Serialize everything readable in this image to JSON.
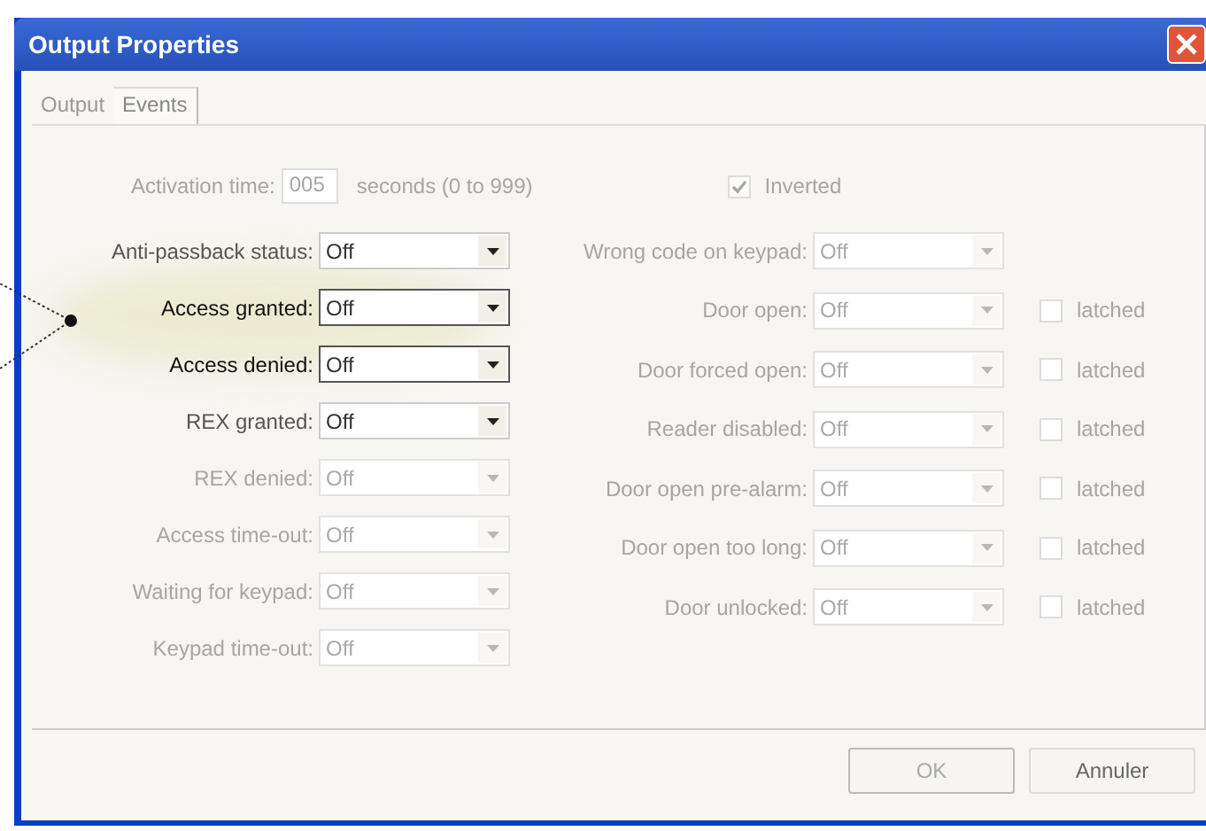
{
  "window": {
    "title": "Output Properties"
  },
  "tabs": [
    {
      "label": "Output",
      "selected": false
    },
    {
      "label": "Events",
      "selected": true
    }
  ],
  "activation": {
    "label": "Activation time:",
    "value": "005",
    "unit": "seconds (0 to 999)",
    "disabled": true
  },
  "inverted": {
    "label": "Inverted",
    "checked": true,
    "disabled": true
  },
  "left_fields": [
    {
      "label": "Anti-passback status:",
      "value": "Off",
      "disabled": false,
      "highlighted": false
    },
    {
      "label": "Access granted:",
      "value": "Off",
      "disabled": false,
      "highlighted": true
    },
    {
      "label": "Access denied:",
      "value": "Off",
      "disabled": false,
      "highlighted": true
    },
    {
      "label": "REX granted:",
      "value": "Off",
      "disabled": false,
      "highlighted": false
    },
    {
      "label": "REX denied:",
      "value": "Off",
      "disabled": true,
      "highlighted": false
    },
    {
      "label": "Access time-out:",
      "value": "Off",
      "disabled": true,
      "highlighted": false
    },
    {
      "label": "Waiting for keypad:",
      "value": "Off",
      "disabled": true,
      "highlighted": false
    },
    {
      "label": "Keypad time-out:",
      "value": "Off",
      "disabled": true,
      "highlighted": false
    }
  ],
  "right_fields": [
    {
      "label": "Wrong code on keypad:",
      "value": "Off",
      "disabled": true
    },
    {
      "label": "Door open:",
      "value": "Off",
      "disabled": true,
      "latched": {
        "label": "latched",
        "checked": false
      }
    },
    {
      "label": "Door forced open:",
      "value": "Off",
      "disabled": true,
      "latched": {
        "label": "latched",
        "checked": false
      }
    },
    {
      "label": "Reader disabled:",
      "value": "Off",
      "disabled": true,
      "latched": {
        "label": "latched",
        "checked": false
      }
    },
    {
      "label": "Door open pre-alarm:",
      "value": "Off",
      "disabled": true,
      "latched": {
        "label": "latched",
        "checked": false
      }
    },
    {
      "label": "Door open too long:",
      "value": "Off",
      "disabled": true,
      "latched": {
        "label": "latched",
        "checked": false
      }
    },
    {
      "label": "Door unlocked:",
      "value": "Off",
      "disabled": true,
      "latched": {
        "label": "latched",
        "checked": false
      }
    }
  ],
  "buttons": [
    {
      "label": "OK",
      "disabled": true
    },
    {
      "label": "Annuler",
      "disabled": false
    }
  ]
}
